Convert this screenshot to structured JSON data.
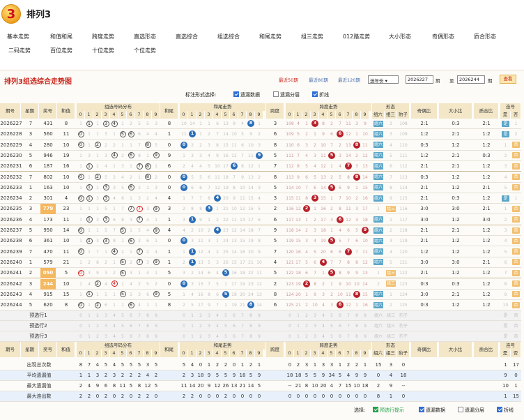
{
  "app": {
    "title": "排列3",
    "logo_text": "3"
  },
  "nav": {
    "row1": [
      "基本走势",
      "和值和尾",
      "跨度走势",
      "直选形态",
      "直选综合",
      "组选综合",
      "和尾走势",
      "组三走势",
      "012路走势",
      "大小形态",
      "奇偶形态",
      "质合形态"
    ],
    "row2": [
      "二码走势",
      "百位走势",
      "十位走势",
      "个位走势"
    ]
  },
  "panel": {
    "title": "排列3组选综合走势图",
    "links": [
      "最近50期",
      "最近80期",
      "最近120期"
    ],
    "select_value": "选年份",
    "from_value": "2026227",
    "from_suffix": "期",
    "to_label": "至",
    "to_value": "2026244",
    "to_suffix": "期",
    "view_button": "查看",
    "options_label": "标注形式选择:",
    "options": [
      {
        "label": "遗漏数据",
        "checked": true
      },
      {
        "label": "遗漏分层",
        "checked": false
      },
      {
        "label": "折线",
        "checked": true
      }
    ]
  },
  "headers": {
    "issue": "期号",
    "week": "星期",
    "prize": "奖号",
    "sum": "和值",
    "group_dist": "组选号码分布",
    "sum_tail": "和尾",
    "tail_trend": "和尾走势",
    "span": "跨度",
    "span_trend": "跨度走势",
    "shape": "形态",
    "shape_sub": [
      "组六",
      "组三",
      "豹子"
    ],
    "odd_even": "奇偶比",
    "big_small": "大小比",
    "prime": "质合比",
    "repeat": "连号",
    "repeat_sub": [
      "是",
      "否"
    ],
    "digits": [
      "0",
      "1",
      "2",
      "3",
      "4",
      "5",
      "6",
      "7",
      "8",
      "9"
    ]
  },
  "rows": [
    {
      "issue": "2026227",
      "week": "7",
      "prize": "431",
      "sum": "8",
      "grp": [
        "1",
        "①",
        "1",
        "③",
        "④",
        "1",
        "2",
        "5",
        "5",
        "3"
      ],
      "tail": "8",
      "tt": [
        "10",
        "14",
        "1",
        "1",
        "6",
        "13",
        "9",
        "4",
        "8",
        "1"
      ],
      "tball": 8,
      "span": "3",
      "st": [
        "108",
        "4",
        "1",
        "3",
        "8",
        "2",
        "7",
        "11",
        "3",
        "9"
      ],
      "sball": 3,
      "shape": [
        "组六",
        "2",
        "108"
      ],
      "oe": "2:1",
      "bs": "0:3",
      "pc": "2:1",
      "rep": [
        "是",
        "1"
      ]
    },
    {
      "issue": "2026228",
      "week": "3",
      "prize": "560",
      "sum": "11",
      "grp": [
        "⓪",
        "1",
        "1",
        "3",
        "1",
        "⑤",
        "⑥",
        "6",
        "4",
        "4"
      ],
      "tail": "1",
      "tt": [
        "11",
        "1",
        "1",
        "2",
        "7",
        "14",
        "10",
        "5",
        "9",
        "2"
      ],
      "tball": 1,
      "span": "6",
      "st": [
        "109",
        "5",
        "2",
        "1",
        "9",
        "6",
        "6",
        "12",
        "1",
        "10"
      ],
      "sball": 6,
      "shape": [
        "组六",
        "3",
        "109"
      ],
      "oe": "1:2",
      "bs": "2:1",
      "pc": "1:2",
      "rep": [
        "是",
        "2"
      ]
    },
    {
      "issue": "2026229",
      "week": "4",
      "prize": "280",
      "sum": "10",
      "grp": [
        "⓪",
        "1",
        "②",
        "2",
        "2",
        "1",
        "1",
        "7",
        "⑧",
        "5"
      ],
      "tail": "0",
      "tt": [
        "0",
        "2",
        "2",
        "3",
        "8",
        "15",
        "11",
        "6",
        "10",
        "3"
      ],
      "tball": 0,
      "span": "8",
      "st": [
        "110",
        "6",
        "3",
        "2",
        "10",
        "7",
        "2",
        "13",
        "8",
        "11"
      ],
      "sball": 8,
      "shape": [
        "组六",
        "4",
        "110"
      ],
      "oe": "0:3",
      "bs": "1:2",
      "pc": "1:2",
      "rep": [
        "1",
        "否"
      ]
    },
    {
      "issue": "2026230",
      "week": "5",
      "prize": "946",
      "sum": "19",
      "grp": [
        "1",
        "3",
        "1",
        "3",
        "④",
        "2",
        "⑥",
        "8",
        "1",
        "⑨"
      ],
      "tail": "9",
      "tt": [
        "1",
        "3",
        "3",
        "4",
        "9",
        "16",
        "12",
        "7",
        "11",
        "9"
      ],
      "tball": 9,
      "span": "5",
      "st": [
        "111",
        "7",
        "4",
        "3",
        "11",
        "5",
        "3",
        "14",
        "2",
        "12"
      ],
      "sball": 5,
      "shape": [
        "组六",
        "5",
        "111"
      ],
      "oe": "1:2",
      "bs": "2:1",
      "pc": "0:3",
      "rep": [
        "2",
        "否"
      ]
    },
    {
      "issue": "2026231",
      "week": "6",
      "prize": "187",
      "sum": "16",
      "grp": [
        "1",
        "①",
        "2",
        "4",
        "1",
        "3",
        "1",
        "⑦",
        "⑧",
        "1"
      ],
      "tail": "6",
      "tt": [
        "2",
        "4",
        "4",
        "5",
        "10",
        "17",
        "6",
        "8",
        "12",
        "1"
      ],
      "tball": 6,
      "span": "7",
      "st": [
        "112",
        "8",
        "5",
        "4",
        "12",
        "1",
        "4",
        "7",
        "3",
        "13"
      ],
      "sball": 7,
      "shape": [
        "组六",
        "6",
        "112"
      ],
      "oe": "2:1",
      "bs": "2:1",
      "pc": "1:2",
      "rep": [
        "3",
        "否"
      ]
    },
    {
      "issue": "2026232",
      "week": "7",
      "prize": "802",
      "sum": "10",
      "grp": [
        "⓪",
        "1",
        "②",
        "5",
        "2",
        "4",
        "2",
        "1",
        "⑧",
        "2"
      ],
      "tail": "0",
      "tt": [
        "0",
        "5",
        "5",
        "6",
        "11",
        "18",
        "7",
        "9",
        "13",
        "2"
      ],
      "tball": 0,
      "span": "8",
      "st": [
        "113",
        "9",
        "6",
        "5",
        "13",
        "2",
        "5",
        "8",
        "8",
        "14"
      ],
      "sball": 8,
      "shape": [
        "组六",
        "7",
        "113"
      ],
      "oe": "0:3",
      "bs": "1:2",
      "pc": "1:2",
      "rep": [
        "4",
        "否"
      ]
    },
    {
      "issue": "2026233",
      "week": "1",
      "prize": "163",
      "sum": "10",
      "grp": [
        "1",
        "①",
        "1",
        "③",
        "3",
        "5",
        "⑥",
        "2",
        "1",
        "3"
      ],
      "tail": "0",
      "tt": [
        "0",
        "6",
        "6",
        "7",
        "12",
        "19",
        "8",
        "10",
        "14",
        "3"
      ],
      "tball": 0,
      "span": "5",
      "st": [
        "114",
        "10",
        "7",
        "6",
        "14",
        "5",
        "6",
        "9",
        "1",
        "15"
      ],
      "sball": 5,
      "shape": [
        "组六",
        "8",
        "114"
      ],
      "oe": "2:1",
      "bs": "1:2",
      "pc": "2:1",
      "rep": [
        "5",
        "否"
      ]
    },
    {
      "issue": "2026234",
      "week": "2",
      "prize": "301",
      "sum": "4",
      "grp": [
        "⓪",
        "①",
        "3",
        "③",
        "4",
        "6",
        "1",
        "3",
        "2",
        "4"
      ],
      "tail": "4",
      "tt": [
        "1",
        "7",
        "7",
        "8",
        "4",
        "20",
        "9",
        "11",
        "15",
        "4"
      ],
      "tball": 4,
      "span": "3",
      "st": [
        "115",
        "11",
        "8",
        "3",
        "15",
        "1",
        "7",
        "10",
        "2",
        "16"
      ],
      "sball": 3,
      "shape": [
        "组六",
        "9",
        "115"
      ],
      "oe": "2:1",
      "bs": "0:3",
      "pc": "1:2",
      "rep": [
        "是",
        "1"
      ]
    },
    {
      "issue": "2026235",
      "week": "3",
      "prize": "779",
      "sum": "23",
      "grp": [
        "1",
        "1",
        "1",
        "5",
        "1",
        "7",
        "⑦",
        "⑦",
        "3",
        "⑨"
      ],
      "tail": "3",
      "tt": [
        "2",
        "8",
        "8",
        "3",
        "1",
        "21",
        "10",
        "12",
        "16",
        "5"
      ],
      "tball": 3,
      "span": "2",
      "st": [
        "116",
        "12",
        "2",
        "1",
        "16",
        "2",
        "8",
        "11",
        "3",
        "17"
      ],
      "sball": 2,
      "shape": [
        "1",
        "组三",
        "116"
      ],
      "oe": "3:0",
      "bs": "3:0",
      "pc": "2:1",
      "rep": [
        "1",
        "否"
      ]
    },
    {
      "issue": "2026236",
      "week": "4",
      "prize": "173",
      "sum": "11",
      "grp": [
        "1",
        "①",
        "3",
        "③",
        "6",
        "8",
        "3",
        "⑦",
        "4",
        "1"
      ],
      "tail": "1",
      "tt": [
        "3",
        "1",
        "9",
        "1",
        "2",
        "22",
        "11",
        "13",
        "17",
        "6"
      ],
      "tball": 1,
      "span": "6",
      "st": [
        "117",
        "13",
        "1",
        "2",
        "17",
        "3",
        "6",
        "12",
        "4",
        "18"
      ],
      "sball": 6,
      "shape": [
        "组六",
        "1",
        "117"
      ],
      "oe": "3:0",
      "bs": "1:2",
      "pc": "3:0",
      "rep": [
        "2",
        "否"
      ]
    },
    {
      "issue": "2026237",
      "week": "5",
      "prize": "950",
      "sum": "14",
      "grp": [
        "⓪",
        "1",
        "1",
        "5",
        "7",
        "⑤",
        "1",
        "5",
        "4",
        "⑨"
      ],
      "tail": "4",
      "tt": [
        "4",
        "2",
        "10",
        "2",
        "4",
        "23",
        "12",
        "14",
        "18",
        "7"
      ],
      "tball": 4,
      "span": "9",
      "st": [
        "118",
        "14",
        "2",
        "3",
        "18",
        "1",
        "4",
        "6",
        "5",
        "9"
      ],
      "sball": 9,
      "shape": [
        "组六",
        "2",
        "118"
      ],
      "oe": "2:1",
      "bs": "2:1",
      "pc": "1:2",
      "rep": [
        "3",
        "否"
      ]
    },
    {
      "issue": "2026238",
      "week": "6",
      "prize": "361",
      "sum": "10",
      "grp": [
        "1",
        "①",
        "3",
        "③",
        "8",
        "1",
        "⑥",
        "2",
        "6",
        "1"
      ],
      "tail": "0",
      "tt": [
        "0",
        "3",
        "11",
        "3",
        "1",
        "24",
        "13",
        "15",
        "19",
        "8"
      ],
      "tball": 0,
      "span": "5",
      "st": [
        "119",
        "15",
        "3",
        "4",
        "19",
        "5",
        "5",
        "7",
        "6",
        "10"
      ],
      "sball": 5,
      "shape": [
        "组六",
        "3",
        "119"
      ],
      "oe": "2:1",
      "bs": "1:2",
      "pc": "1:2",
      "rep": [
        "4",
        "否"
      ]
    },
    {
      "issue": "2026239",
      "week": "7",
      "prize": "470",
      "sum": "11",
      "grp": [
        "⓪",
        "1",
        "7",
        "1",
        "④",
        "2",
        "1",
        "⑦",
        "2",
        "4"
      ],
      "tail": "1",
      "tt": [
        "1",
        "1",
        "12",
        "4",
        "2",
        "25",
        "14",
        "16",
        "20",
        "9"
      ],
      "tball": 1,
      "span": "7",
      "st": [
        "120",
        "16",
        "4",
        "5",
        "20",
        "6",
        "6",
        "7",
        "7",
        "11"
      ],
      "sball": 7,
      "shape": [
        "组六",
        "4",
        "120"
      ],
      "oe": "1:2",
      "bs": "1:2",
      "pc": "1:2",
      "rep": [
        "5",
        "否"
      ]
    },
    {
      "issue": "2026240",
      "week": "1",
      "prize": "579",
      "sum": "21",
      "grp": [
        "1",
        "2",
        "8",
        "2",
        "1",
        "⑤",
        "2",
        "⑦",
        "3",
        "⑨"
      ],
      "tail": "1",
      "tt": [
        "2",
        "1",
        "13",
        "5",
        "3",
        "26",
        "15",
        "17",
        "21",
        "10"
      ],
      "tball": 1,
      "span": "4",
      "st": [
        "121",
        "17",
        "5",
        "6",
        "4",
        "7",
        "7",
        "8",
        "8",
        "12"
      ],
      "sball": 4,
      "shape": [
        "组六",
        "5",
        "121"
      ],
      "oe": "3:0",
      "bs": "3:0",
      "pc": "2:1",
      "rep": [
        "6",
        "否"
      ]
    },
    {
      "issue": "2026241",
      "week": "2",
      "prize": "050",
      "sum": "5",
      "grp": [
        "⓪",
        "3",
        "9",
        "3",
        "2",
        "⑤",
        "3",
        "1",
        "4",
        "1"
      ],
      "tail": "5",
      "tt": [
        "3",
        "2",
        "14",
        "6",
        "4",
        "5",
        "16",
        "18",
        "22",
        "11"
      ],
      "tball": 5,
      "span": "5",
      "st": [
        "122",
        "18",
        "6",
        "7",
        "1",
        "5",
        "8",
        "9",
        "9",
        "13"
      ],
      "sball": 5,
      "shape": [
        "1",
        "组三",
        "122"
      ],
      "oe": "2:1",
      "bs": "1:2",
      "pc": "1:2",
      "rep": [
        "7",
        "否"
      ]
    },
    {
      "issue": "2026242",
      "week": "3",
      "prize": "244",
      "sum": "10",
      "grp": [
        "1",
        "4",
        "②",
        "4",
        "④",
        "1",
        "4",
        "2",
        "5",
        "2"
      ],
      "tail": "0",
      "tt": [
        "0",
        "3",
        "15",
        "7",
        "5",
        "1",
        "17",
        "19",
        "23",
        "12"
      ],
      "tball": 0,
      "span": "2",
      "st": [
        "123",
        "19",
        "2",
        "8",
        "2",
        "1",
        "9",
        "10",
        "10",
        "14"
      ],
      "sball": 2,
      "shape": [
        "2",
        "组三",
        "123"
      ],
      "oe": "0:3",
      "bs": "0:3",
      "pc": "1:2",
      "rep": [
        "8",
        "否"
      ]
    },
    {
      "issue": "2026243",
      "week": "4",
      "prize": "915",
      "sum": "15",
      "grp": [
        "1",
        "①",
        "1",
        "5",
        "1",
        "⑤",
        "5",
        "3",
        "6",
        "⑨"
      ],
      "tail": "5",
      "tt": [
        "1",
        "4",
        "16",
        "8",
        "6",
        "5",
        "18",
        "20",
        "24",
        "13"
      ],
      "tball": 5,
      "span": "8",
      "st": [
        "124",
        "20",
        "1",
        "9",
        "3",
        "2",
        "10",
        "11",
        "8",
        "15"
      ],
      "sball": 8,
      "shape": [
        "组六",
        "1",
        "124"
      ],
      "oe": "3:0",
      "bs": "2:1",
      "pc": "1:2",
      "rep": [
        "9",
        "否"
      ]
    },
    {
      "issue": "2026244",
      "week": "5",
      "prize": "620",
      "sum": "8",
      "grp": [
        "⓪",
        "1",
        "②",
        "6",
        "1",
        "1",
        "⑥",
        "4",
        "1",
        "1"
      ],
      "tail": "8",
      "tt": [
        "2",
        "5",
        "17",
        "9",
        "7",
        "1",
        "19",
        "21",
        "8",
        "14"
      ],
      "tball": 8,
      "span": "6",
      "st": [
        "125",
        "21",
        "2",
        "10",
        "4",
        "3",
        "6",
        "12",
        "1",
        "16"
      ],
      "sball": 6,
      "shape": [
        "组六",
        "2",
        "125"
      ],
      "oe": "0:3",
      "bs": "1:2",
      "pc": "1:2",
      "rep": [
        "10",
        "否"
      ]
    }
  ],
  "predict": {
    "labels": [
      "预选行1",
      "预选行2",
      "预选行3"
    ],
    "shape": [
      "组六",
      "组三",
      "豹子"
    ],
    "rep": [
      "是",
      "否"
    ]
  },
  "stats": [
    {
      "label": "出现总次数",
      "grp": [
        "8",
        "7",
        "4",
        "5",
        "4",
        "5",
        "5",
        "5",
        "3",
        "5"
      ],
      "tt": [
        "5",
        "4",
        "0",
        "1",
        "2",
        "2",
        "0",
        "1",
        "2",
        "1"
      ],
      "st": [
        "0",
        "2",
        "3",
        "1",
        "3",
        "3",
        "1",
        "2",
        "2",
        "1"
      ],
      "shape": [
        "15",
        "3",
        "0"
      ],
      "rep": [
        "1",
        "17"
      ]
    },
    {
      "label": "平均遗漏值",
      "grp": [
        "1",
        "1",
        "3",
        "2",
        "3",
        "2",
        "2",
        "2",
        "4",
        "2"
      ],
      "tt": [
        "2",
        "3",
        "18",
        "9",
        "5",
        "5",
        "9",
        "18",
        "5",
        "9"
      ],
      "st": [
        "18",
        "18",
        "5",
        "5",
        "9",
        "34",
        "5",
        "4",
        "9",
        "9"
      ],
      "shape": [
        "0",
        "4",
        "18"
      ],
      "rep": [
        "9",
        "0"
      ]
    },
    {
      "label": "最大遗漏值",
      "grp": [
        "2",
        "4",
        "9",
        "6",
        "8",
        "11",
        "5",
        "8",
        "12",
        "5"
      ],
      "tt": [
        "11",
        "14",
        "20",
        "9",
        "12",
        "26",
        "13",
        "21",
        "14",
        "5"
      ],
      "st": [
        "--",
        "21",
        "8",
        "10",
        "20",
        "4",
        "7",
        "15",
        "10",
        "18"
      ],
      "shape": [
        "2",
        "9",
        "--"
      ],
      "rep": [
        "10",
        "1"
      ]
    },
    {
      "label": "最大连出数",
      "grp": [
        "2",
        "2",
        "0",
        "2",
        "0",
        "2",
        "0",
        "2",
        "2",
        "0"
      ],
      "tt": [
        "2",
        "2",
        "0",
        "0",
        "0",
        "2",
        "0",
        "0",
        "0",
        "0"
      ],
      "st": [
        "0",
        "0",
        "0",
        "0",
        "0",
        "0",
        "0",
        "0",
        "0",
        "0"
      ],
      "shape": [
        "8",
        "1",
        "0"
      ],
      "rep": [
        "1",
        "15"
      ]
    }
  ],
  "footer": {
    "label": "选择:",
    "options": [
      {
        "label": "预选行提示",
        "checked": true,
        "green": true
      },
      {
        "label": "遗漏数据",
        "checked": true
      },
      {
        "label": "遗漏分层",
        "checked": false
      },
      {
        "label": "折线",
        "checked": true
      }
    ]
  },
  "colors": {
    "accent_red": "#c8281e",
    "ball_blue": "#2a6db8",
    "ball_red": "#b8202a",
    "header_bg": "#f3e7c8"
  }
}
